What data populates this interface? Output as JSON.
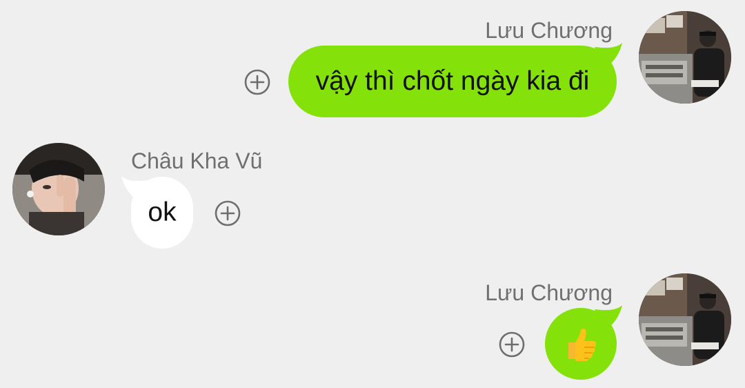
{
  "messages": [
    {
      "sender": "Lưu Chương",
      "text": "vậy thì chốt ngày kia đi",
      "direction": "outgoing"
    },
    {
      "sender": "Châu Kha Vũ",
      "text": "ok",
      "direction": "incoming"
    },
    {
      "sender": "Lưu Chương",
      "sticker": "thumbs-up-emoji",
      "direction": "outgoing"
    }
  ],
  "colors": {
    "background": "#efefef",
    "outgoing_bubble": "#84e10a",
    "incoming_bubble": "#ffffff",
    "sender_name": "#6f6f6f",
    "icon_gray": "#6d6d6d"
  },
  "icons": {
    "react": "add-reaction-icon",
    "sticker": "thumbs-up-emoji"
  }
}
